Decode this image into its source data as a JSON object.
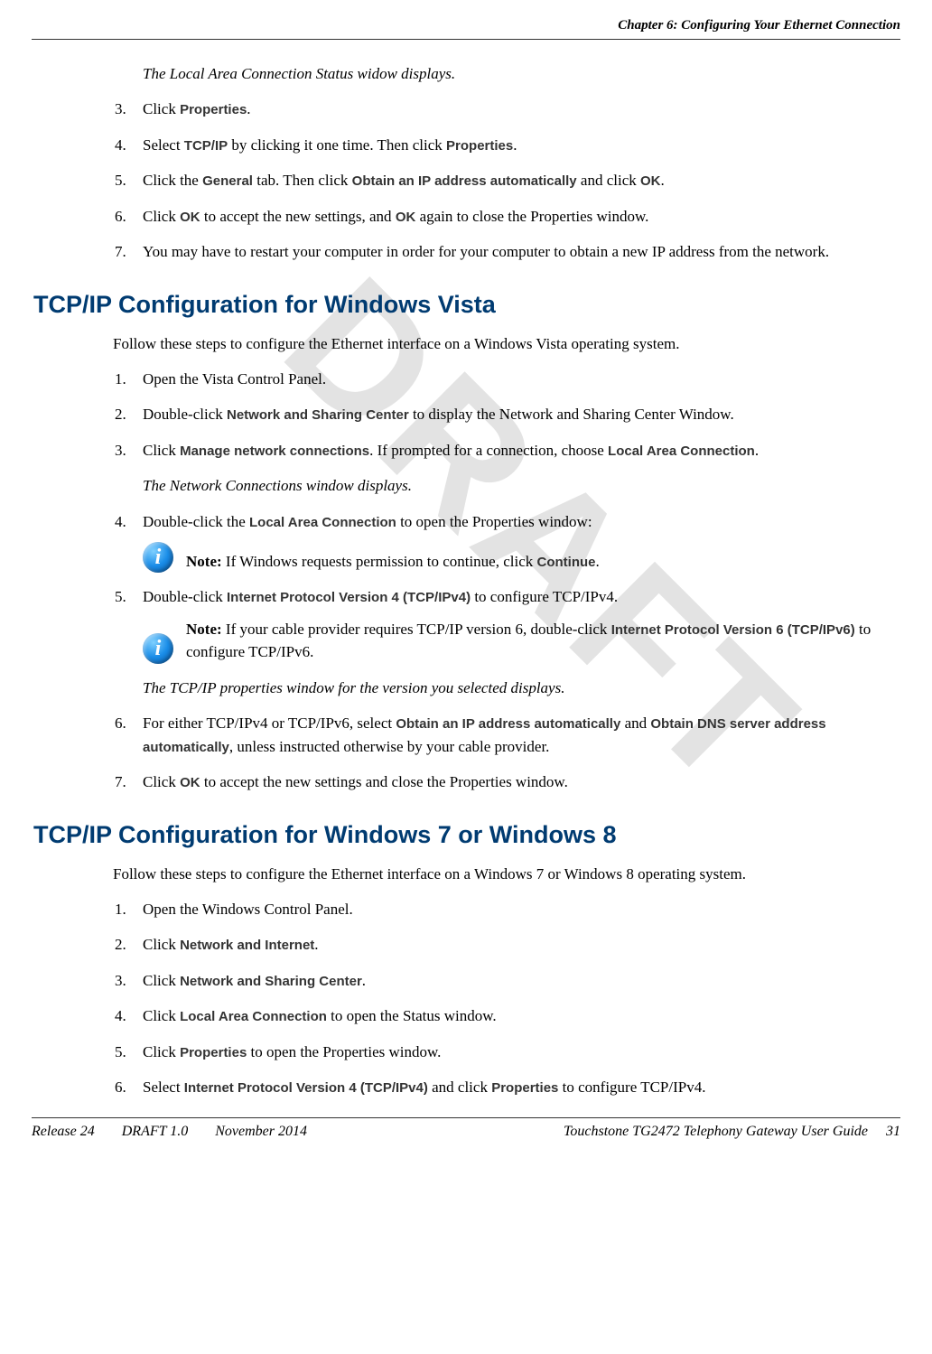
{
  "header": {
    "chapter": "Chapter 6: Configuring Your Ethernet Connection"
  },
  "watermark": "DRAFT",
  "section1": {
    "intro_italic": "The Local Area Connection Status widow displays.",
    "steps": [
      {
        "n": "3.",
        "pre": "Click ",
        "ui1": "Properties",
        "post1": "."
      },
      {
        "n": "4.",
        "pre": "Select ",
        "ui1": "TCP/IP",
        "mid1": " by clicking it one time. Then click ",
        "ui2": "Properties",
        "post2": "."
      },
      {
        "n": "5.",
        "pre": "Click the ",
        "ui1": "General",
        "mid1": " tab. Then click ",
        "ui2": "Obtain an IP address automatically",
        "mid2": " and click ",
        "ui3": "OK",
        "post3": "."
      },
      {
        "n": "6.",
        "pre": "Click ",
        "ui1": "OK",
        "mid1": " to accept the new settings, and ",
        "ui2": "OK",
        "post2": " again to close the Properties window."
      },
      {
        "n": "7.",
        "text": "You may have to restart your computer in order for your computer to obtain a new IP address from the network."
      }
    ]
  },
  "section2": {
    "heading": "TCP/IP Configuration for Windows Vista",
    "intro": "Follow these steps to configure the Ethernet interface on a Windows Vista operating system.",
    "steps": [
      {
        "n": "1.",
        "text": "Open the Vista Control Panel."
      },
      {
        "n": "2.",
        "pre": "Double-click ",
        "ui1": "Network and Sharing Center",
        "post1": " to display the Network and Sharing Center Window."
      },
      {
        "n": "3.",
        "pre": "Click ",
        "ui1": "Manage network connections",
        "mid1": ". If prompted for a connection, choose ",
        "ui2": "Local Area Connection",
        "post2": ".",
        "sub_italic": "The Network Connections window displays."
      },
      {
        "n": "4.",
        "pre": "Double-click the ",
        "ui1": "Local Area Connection",
        "post1": " to open the Properties window:",
        "note_label": "Note:",
        "note_pre": " If Windows requests permission to continue, click ",
        "note_ui": "Continue",
        "note_post": "."
      },
      {
        "n": "5.",
        "pre": "Double-click ",
        "ui1": "Internet Protocol Version 4 (TCP/IPv4)",
        "post1": " to configure TCP/IPv4.",
        "note_label": "Note:",
        "note_pre": " If your cable provider requires TCP/IP version 6, double-click ",
        "note_ui": "Internet Protocol Version 6 (TCP/IPv6)",
        "note_post": " to configure TCP/IPv6.",
        "sub_italic": "The TCP/IP properties window for the version you selected displays."
      },
      {
        "n": "6.",
        "pre": "For either TCP/IPv4 or TCP/IPv6, select ",
        "ui1": "Obtain an IP address automatically",
        "mid1": " and ",
        "ui2": "Obtain DNS server address automatically",
        "post2": ", unless instructed otherwise by your cable provider."
      },
      {
        "n": "7.",
        "pre": "Click ",
        "ui1": "OK",
        "post1": " to accept the new settings and close the Properties window."
      }
    ]
  },
  "section3": {
    "heading": "TCP/IP Configuration for Windows 7 or Windows 8",
    "intro": "Follow these steps to configure the Ethernet interface on a Windows 7 or Windows 8 operating system.",
    "steps": [
      {
        "n": "1.",
        "text": "Open the Windows Control Panel."
      },
      {
        "n": "2.",
        "pre": "Click ",
        "ui1": "Network and Internet",
        "post1": "."
      },
      {
        "n": "3.",
        "pre": "Click ",
        "ui1": "Network and Sharing Center",
        "post1": "."
      },
      {
        "n": "4.",
        "pre": "Click ",
        "ui1": "Local Area Connection",
        "post1": " to open the Status window."
      },
      {
        "n": "5.",
        "pre": "Click ",
        "ui1": "Properties",
        "post1": " to open the Properties window."
      },
      {
        "n": "6.",
        "pre": "Select ",
        "ui1": "Internet Protocol Version 4 (TCP/IPv4)",
        "mid1": " and click ",
        "ui2": "Properties",
        "post2": " to configure TCP/IPv4."
      }
    ]
  },
  "footer": {
    "release": "Release 24",
    "draft": "DRAFT 1.0",
    "date": "November 2014",
    "title": "Touchstone TG2472 Telephony Gateway User Guide",
    "page": "31"
  }
}
